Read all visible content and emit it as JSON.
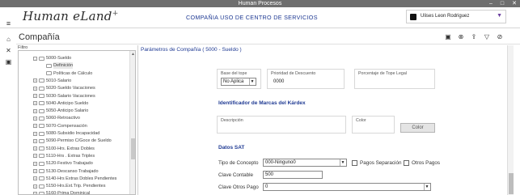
{
  "window": {
    "title": "Human Procesos",
    "controls": [
      "–",
      "□",
      "✕"
    ]
  },
  "header": {
    "logo_text": "Human eLand",
    "logo_mark": "+",
    "company_name": "COMPAÑIA USO DE CENTRO DE SERVICIOS",
    "user_name": "Ulises Leon Rodriguez"
  },
  "sidebar_icons": [
    "menu-icon",
    "home-icon",
    "tools-icon",
    "image-icon"
  ],
  "page": {
    "title": "Compañía",
    "toolbar": [
      "save-icon",
      "clear-icon",
      "export-icon",
      "filter-icon",
      "close-icon"
    ]
  },
  "tree": {
    "filter_label": "Filtro",
    "items": [
      {
        "label": "5000-Sueldo",
        "level": 1,
        "expander": "-"
      },
      {
        "label": "Definición",
        "level": 2,
        "expander": "",
        "selected": true
      },
      {
        "label": "Políticas de Cálculo",
        "level": 2,
        "expander": ""
      },
      {
        "label": "5010-Salario",
        "level": 1,
        "expander": "+"
      },
      {
        "label": "5020-Sueldo Vacaciones",
        "level": 1,
        "expander": "+"
      },
      {
        "label": "5030-Salario Vacaciones",
        "level": 1,
        "expander": "+"
      },
      {
        "label": "5040-Anticipo Sueldo",
        "level": 1,
        "expander": "+"
      },
      {
        "label": "5050-Anticipo Salario",
        "level": 1,
        "expander": "+"
      },
      {
        "label": "5060-Retroactivo",
        "level": 1,
        "expander": "+"
      },
      {
        "label": "5070-Compensación",
        "level": 1,
        "expander": "+"
      },
      {
        "label": "5080-Subsidio Incapacidad",
        "level": 1,
        "expander": "+"
      },
      {
        "label": "5090-Permiso C/Goce de Sueldo",
        "level": 1,
        "expander": "+"
      },
      {
        "label": "5100-Hrs. Extras Dobles",
        "level": 1,
        "expander": "+"
      },
      {
        "label": "5110-Hrs . Extras Triples",
        "level": 1,
        "expander": "+"
      },
      {
        "label": "5120-Festivo Trabajado",
        "level": 1,
        "expander": "+"
      },
      {
        "label": "5130-Descanso Trabajado",
        "level": 1,
        "expander": "+"
      },
      {
        "label": "5140-Hrs Extras Dobles Pendientes",
        "level": 1,
        "expander": "+"
      },
      {
        "label": "5150-Hrs.Ext.Trip. Pendientes",
        "level": 1,
        "expander": "+"
      },
      {
        "label": "5160-Prima Dominical",
        "level": 1,
        "expander": "+"
      }
    ]
  },
  "form": {
    "title": "Parámetros de Compañía ( 5000 - Sueldo  )",
    "base_tope_label": "Base del tope",
    "base_tope_value": "No Aplica",
    "prioridad_label": "Prioridad de Descuento",
    "prioridad_value": "0000",
    "porcentaje_label": "Porcentaje de Tope Legal",
    "porcentaje_value": "",
    "kardex_section": "Identificador de Marcas del Kárdex",
    "descripcion_label": "Descripción",
    "color_label": "Color",
    "color_button": "Color",
    "sat_section": "Datos SAT",
    "tipo_concepto_label": "Tipo de Concepto",
    "tipo_concepto_value": "000-Ninguno0",
    "pagos_separacion_label": "Pagos Separación",
    "otros_pagos_label": "Otros Pagos",
    "clave_contable_label": "Clave Contable",
    "clave_contable_value": "500",
    "clave_otros_pago_label": "Clave Otros Pago",
    "clave_otros_pago_value": "0"
  }
}
